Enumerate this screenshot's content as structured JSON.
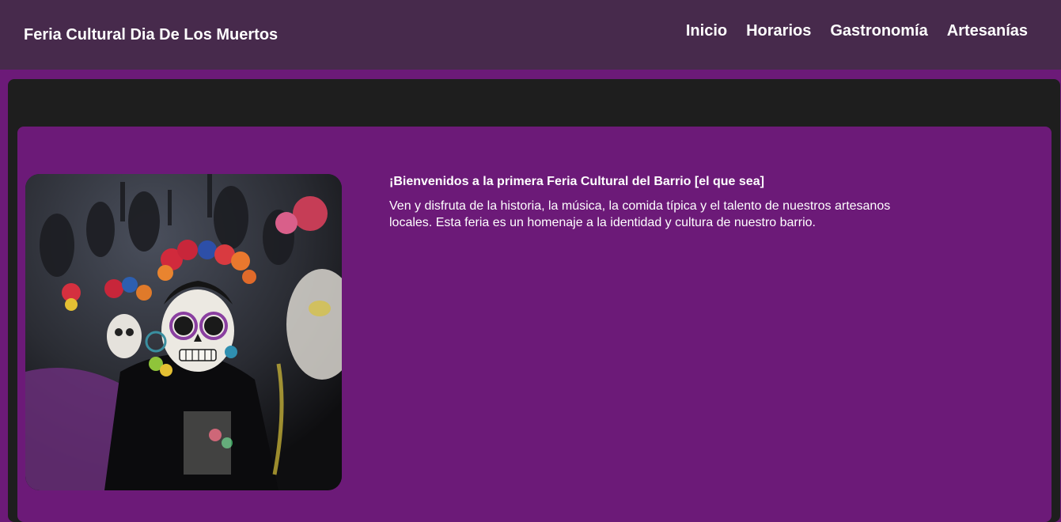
{
  "header": {
    "title": "Feria Cultural Dia De Los Muertos",
    "nav": [
      "Inicio",
      "Horarios",
      "Gastronomía",
      "Artesanías"
    ]
  },
  "hero": {
    "heading": "¡Bienvenidos a la primera Feria Cultural del Barrio [el que sea]",
    "body": "Ven y disfruta de la historia, la música, la comida típica y el talento de nuestros artesanos locales. Esta feria es un homenaje a la identidad y cultura de nuestro barrio.",
    "image_subject": "catrina-parade-photo"
  },
  "colors": {
    "header_bg": "#472a4c",
    "page_bg": "#6c1a78",
    "panel_dark": "#1e1e1e",
    "text": "#ffffff"
  }
}
